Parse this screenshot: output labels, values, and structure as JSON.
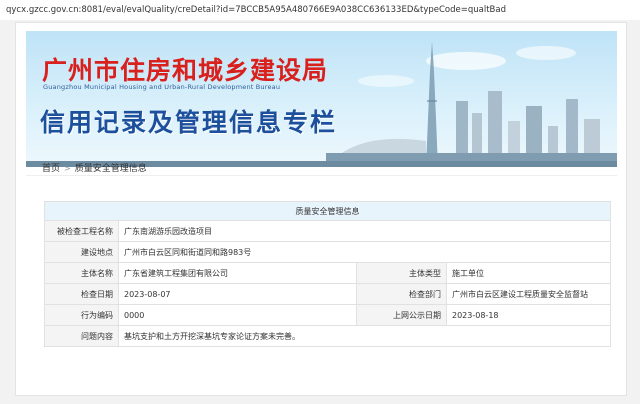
{
  "browser": {
    "url": "qycx.gzcc.gov.cn:8081/eval/evalQuality/creDetail?id=7BCCB5A95A480766E9A038CC636133ED&typeCode=qualtBad"
  },
  "banner": {
    "title": "广州市住房和城乡建设局",
    "subtitle": "Guangzhou Municipal Housing and Urban-Rural Development Bureau",
    "slogan": "信用记录及管理信息专栏"
  },
  "breadcrumb": {
    "home": "首页",
    "separator": ">",
    "current": "质量安全管理信息"
  },
  "info_table": {
    "heading": "质量安全管理信息",
    "project_label": "被检查工程名称",
    "project_value": "广东南湖游乐园改造项目",
    "location_label": "建设地点",
    "location_value": "广州市白云区同和街道同和路983号",
    "entity_label": "主体名称",
    "entity_value": "广东省建筑工程集团有限公司",
    "entity_type_label": "主体类型",
    "entity_type_value": "施工单位",
    "inspect_date_label": "检查日期",
    "inspect_date_value": "2023-08-07",
    "inspect_dept_label": "检查部门",
    "inspect_dept_value": "广州市白云区建设工程质量安全监督站",
    "code_label": "行为编码",
    "code_value": "0000",
    "publish_date_label": "上网公示日期",
    "publish_date_value": "2023-08-18",
    "issue_label": "问题内容",
    "issue_value": "基坑支护和土方开挖深基坑专家论证方案未完善。"
  },
  "colors": {
    "banner_title": "#d9201c",
    "banner_slogan": "#1c4f9c",
    "table_header_bg": "#e8f4fc",
    "label_bg": "#f4f4f4"
  }
}
